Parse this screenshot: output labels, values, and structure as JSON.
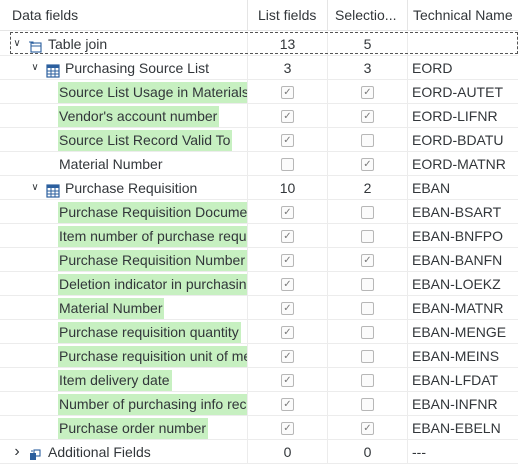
{
  "headers": {
    "data_fields": "Data fields",
    "list_fields": "List fields",
    "selection": "Selectio...",
    "technical_name": "Technical Name"
  },
  "rows": [
    {
      "level": 0,
      "type": "join",
      "expand": "expanded",
      "name": "Table join",
      "list": "13",
      "sel": "5",
      "tech": "",
      "highlight": false,
      "icon": "table-join-icon"
    },
    {
      "level": 1,
      "type": "table",
      "expand": "expanded",
      "name": "Purchasing Source List",
      "list": "3",
      "sel": "3",
      "tech": "EORD",
      "highlight": false,
      "icon": "table-icon"
    },
    {
      "level": 2,
      "type": "field",
      "name": "Source List Usage in Materials",
      "list_checked": true,
      "sel_checked": true,
      "tech": "EORD-AUTET",
      "highlight": true
    },
    {
      "level": 2,
      "type": "field",
      "name": "Vendor's account number",
      "list_checked": true,
      "sel_checked": true,
      "tech": "EORD-LIFNR",
      "highlight": true
    },
    {
      "level": 2,
      "type": "field",
      "name": "Source List Record Valid To",
      "list_checked": true,
      "sel_checked": false,
      "tech": "EORD-BDATU",
      "highlight": true
    },
    {
      "level": 2,
      "type": "field",
      "name": "Material Number",
      "list_checked": false,
      "sel_checked": true,
      "tech": "EORD-MATNR",
      "highlight": false
    },
    {
      "level": 1,
      "type": "table",
      "expand": "expanded",
      "name": "Purchase Requisition",
      "list": "10",
      "sel": "2",
      "tech": "EBAN",
      "highlight": false,
      "icon": "table-icon"
    },
    {
      "level": 2,
      "type": "field",
      "name": "Purchase Requisition Document Type",
      "list_checked": true,
      "sel_checked": false,
      "tech": "EBAN-BSART",
      "highlight": true
    },
    {
      "level": 2,
      "type": "field",
      "name": "Item number of purchase requisition",
      "list_checked": true,
      "sel_checked": false,
      "tech": "EBAN-BNFPO",
      "highlight": true
    },
    {
      "level": 2,
      "type": "field",
      "name": "Purchase Requisition Number",
      "list_checked": true,
      "sel_checked": true,
      "tech": "EBAN-BANFN",
      "highlight": true
    },
    {
      "level": 2,
      "type": "field",
      "name": "Deletion indicator in purchasing document",
      "list_checked": true,
      "sel_checked": false,
      "tech": "EBAN-LOEKZ",
      "highlight": true
    },
    {
      "level": 2,
      "type": "field",
      "name": "Material Number",
      "list_checked": true,
      "sel_checked": false,
      "tech": "EBAN-MATNR",
      "highlight": true
    },
    {
      "level": 2,
      "type": "field",
      "name": "Purchase requisition quantity",
      "list_checked": true,
      "sel_checked": false,
      "tech": "EBAN-MENGE",
      "highlight": true
    },
    {
      "level": 2,
      "type": "field",
      "name": "Purchase requisition unit of measure",
      "list_checked": true,
      "sel_checked": false,
      "tech": "EBAN-MEINS",
      "highlight": true
    },
    {
      "level": 2,
      "type": "field",
      "name": "Item delivery date",
      "list_checked": true,
      "sel_checked": false,
      "tech": "EBAN-LFDAT",
      "highlight": true
    },
    {
      "level": 2,
      "type": "field",
      "name": "Number of purchasing info record",
      "list_checked": true,
      "sel_checked": false,
      "tech": "EBAN-INFNR",
      "highlight": true
    },
    {
      "level": 2,
      "type": "field",
      "name": "Purchase order number",
      "list_checked": true,
      "sel_checked": true,
      "tech": "EBAN-EBELN",
      "highlight": true
    },
    {
      "level": 0,
      "type": "extra",
      "expand": "collapsed",
      "name": "Additional Fields",
      "list": "0",
      "sel": "0",
      "tech": "---",
      "highlight": false,
      "icon": "additional-fields-icon"
    }
  ],
  "colors": {
    "highlight": "#c7f0c1",
    "table_icon": "#2b5f9e",
    "border": "#e5e5e5"
  }
}
